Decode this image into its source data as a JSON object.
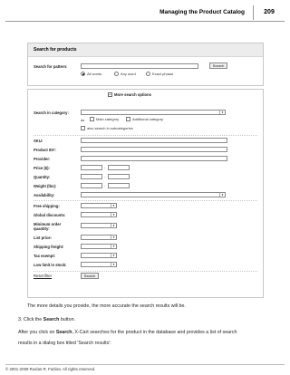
{
  "header": {
    "title": "Managing the Product Catalog",
    "page_number": "209"
  },
  "search_panel": {
    "title": "Search for products",
    "pattern_label": "Search for pattern:",
    "search_button": "Search",
    "options": [
      "All words",
      "Any word",
      "Exact phrase"
    ]
  },
  "main_panel": {
    "more_options": "More search options",
    "category_label": "Search in category:",
    "category_as": "as",
    "main_category": "Main category",
    "additional_category": "Additional category",
    "subcategories": "also search in subcategories",
    "fields": [
      "SKU:",
      "Product ID#:",
      "Provider:",
      "Price ($):",
      "Quantity:",
      "Weight (lbs):",
      "Availability:",
      "Free shipping:",
      "Global discounts:",
      "Minimum order quantity:",
      "List price:",
      "Shipping freight:",
      "Tax exempt:",
      "Low limit in stock:"
    ],
    "reset_filter": "Reset filter",
    "search_button": "Search"
  },
  "body": {
    "note": "The more details you provide, the more accurate the search results will be.",
    "step_prefix": "3. Click the ",
    "step_bold": "Search",
    "step_suffix": " button.",
    "para_prefix": "After you click on ",
    "para_bold": "Search",
    "para_suffix": ", X-Cart searches for the product in the database and provides a list of search",
    "para_line2": "results in a dialog box titled 'Search results':"
  },
  "footer": {
    "copyright": "© 2001-2009 Ruslan R. Fazliev. All rights reserved."
  }
}
